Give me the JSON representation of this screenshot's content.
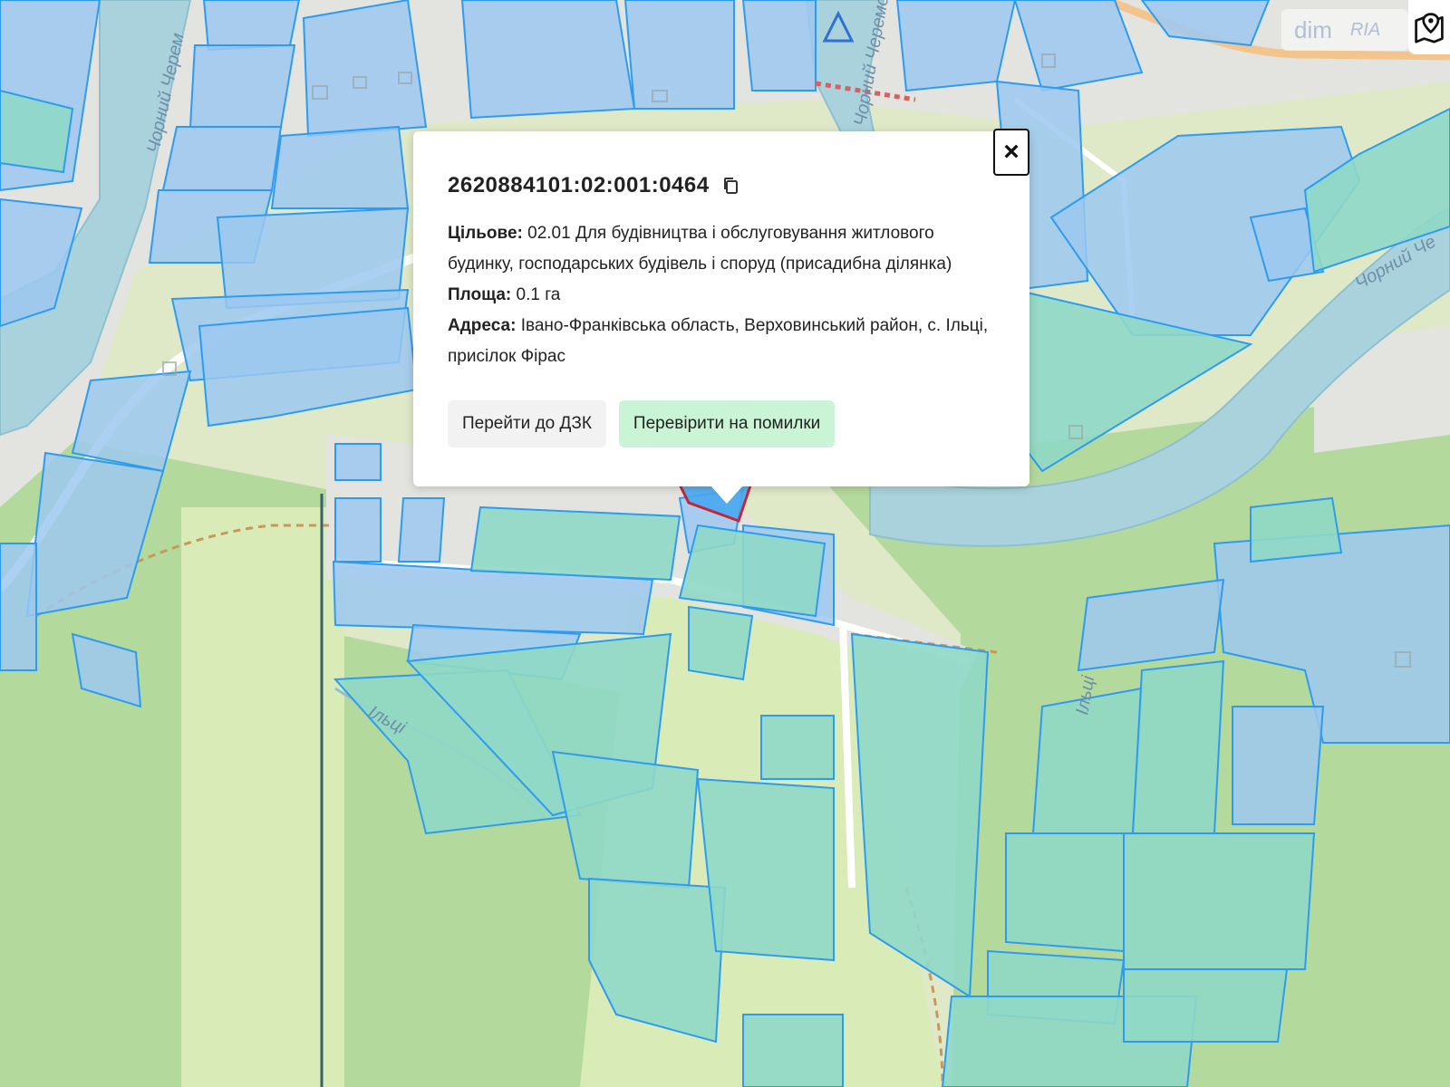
{
  "map": {
    "labels": {
      "river_left": "Чорний Черем",
      "river_top": "Чорний Черемош",
      "river_right": "Чорний Че",
      "stream_left": "Ільці",
      "stream_right": "Ільці"
    },
    "colors": {
      "background": "#dfe9c8",
      "forest": "#a9d393",
      "meadow": "#d8ecb7",
      "river": "#aad2dc",
      "built_area": "#e2e2e2",
      "parcel_residential": "#9cc8f0",
      "parcel_agri": "#8fd8c7",
      "parcel_stroke": "#2d9cf0",
      "selected_parcel_stroke": "#c0283b",
      "path": "#c89858"
    }
  },
  "popup": {
    "cadastral_number": "2620884101:02:001:0464",
    "copy_icon": "copy-icon",
    "purpose_label": "Цільове:",
    "purpose_value": "02.01 Для будівництва і обслуговування житлового будинку, господарських будівель і споруд (присадибна ділянка)",
    "area_label": "Площа:",
    "area_value": "0.1 га",
    "address_label": "Адреса:",
    "address_value": "Івано-Франківська область, Верховинський район, с. Ільці, присілок Фірас",
    "close_label": "×",
    "btn_dzk": "Перейти до ДЗК",
    "btn_check": "Перевірити на помилки"
  },
  "watermark": {
    "text1": "dim",
    "text2": "RIA"
  },
  "controls": {
    "layers_icon": "map-pin-icon"
  }
}
